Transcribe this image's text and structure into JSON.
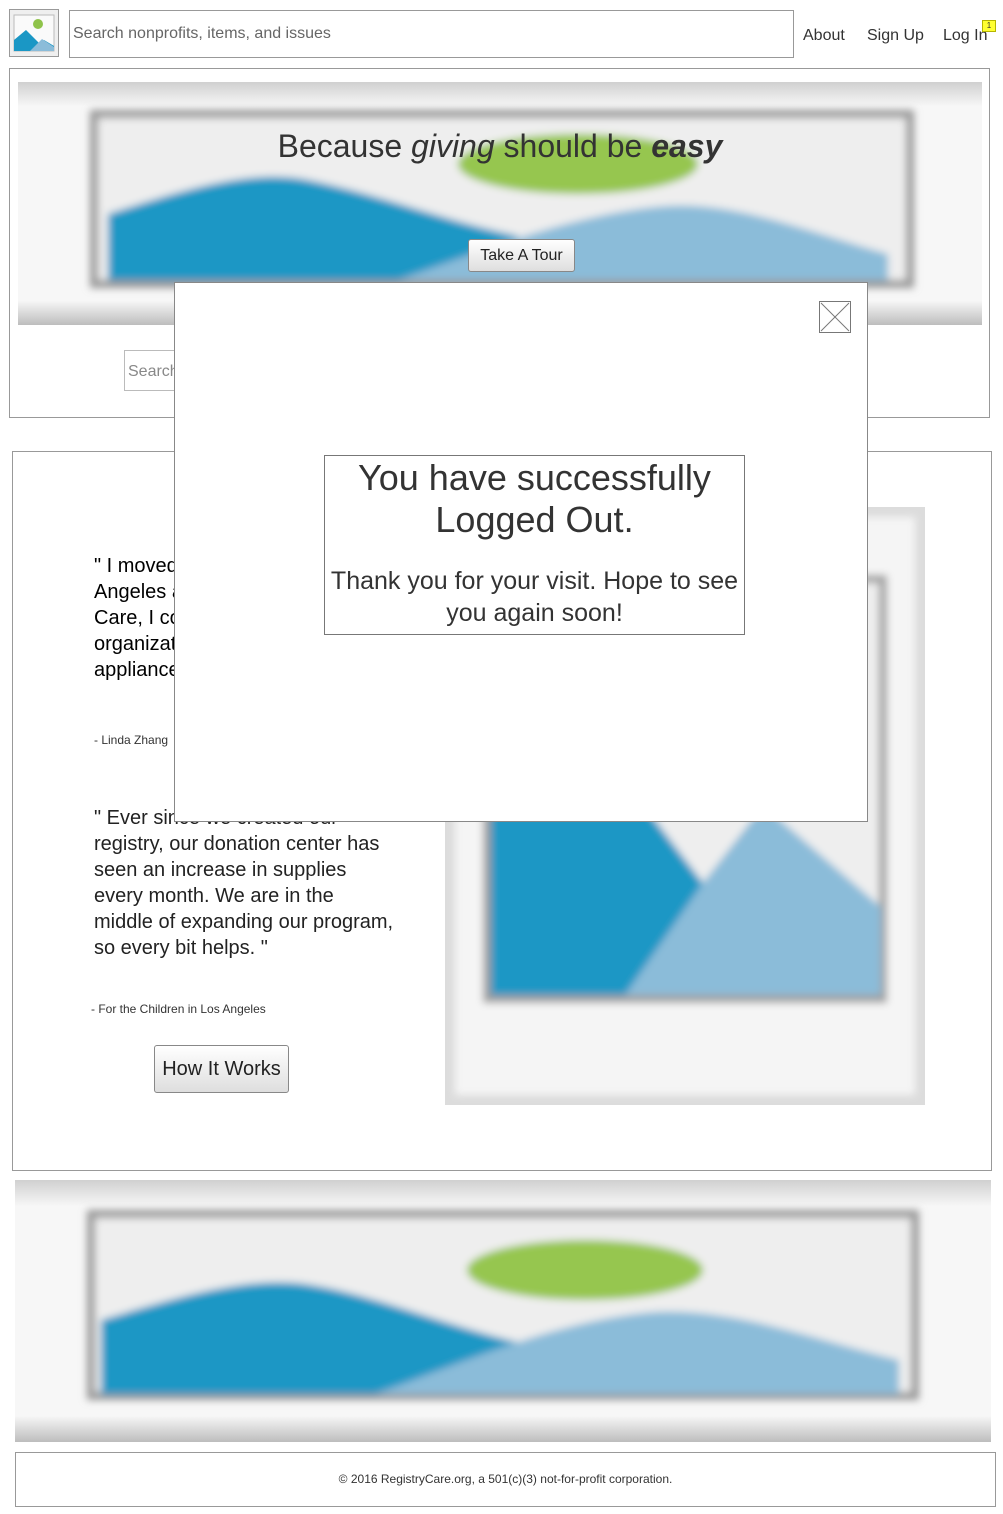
{
  "header": {
    "search_placeholder": "Search nonprofits, items, and issues",
    "nav": {
      "about": "About",
      "sign_up": "Sign Up",
      "log_in": "Log In"
    },
    "login_badge": "1",
    "logo_icon": "image-placeholder-icon"
  },
  "hero": {
    "headline": {
      "part1": "Because ",
      "part2": "giving",
      "part3": " should be ",
      "part4": "easy"
    },
    "tour_button": "Take A Tour",
    "search_placeholder": "Search"
  },
  "testimonials": {
    "quote_1": "\" I moved from Chicago to Los Angeles and by using Registry Care, I connected with a local organization that will take my appliances.\"",
    "attrib_1": "- Linda Zhang",
    "quote_2": "\" Ever since we created our registry, our donation center has seen an increase in supplies every month. We are in the middle of expanding our program, so every bit helps. \"",
    "attrib_2": "- For the Children in Los Angeles",
    "how_button": "How It Works"
  },
  "footer": {
    "text": "© 2016 RegistryCare.org, a 501(c)(3) not-for-profit corporation."
  },
  "modal": {
    "title": "You have successfully Logged Out.",
    "message": "Thank you for your visit. Hope to see you again soon!",
    "close_icon": "close-x-icon"
  },
  "colors": {
    "sky_dark": "#1a97c5",
    "sky_light": "#8bbcd9",
    "sun": "#9bc854",
    "frame": "#cccccc",
    "border": "#999999"
  }
}
